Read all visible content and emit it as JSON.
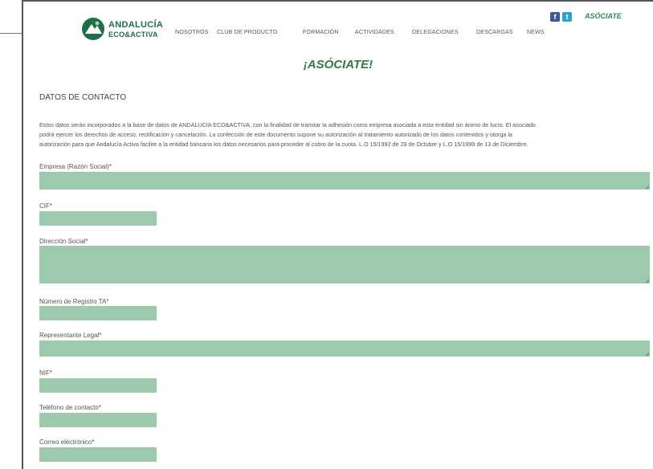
{
  "header": {
    "logo_line1": "ANDALUCÍA",
    "logo_line2": "ECO&ACTIVA",
    "nav": [
      "NOSOTROS",
      "CLUB DE PRODUCTO",
      "FORMACIÓN",
      "ACTIVIDADES",
      "DELEGACIONES",
      "DESCARGAS",
      "NEWS"
    ],
    "social": {
      "facebook_glyph": "f",
      "twitter_glyph": "t",
      "facebook_icon": "facebook-icon",
      "twitter_icon": "twitter-icon"
    },
    "asociate_link": "ASÓCIATE"
  },
  "page": {
    "title": "¡ASÓCIATE!",
    "section_title": "DATOS DE CONTACTO",
    "legal_lines": [
      "Estos datos serán incorporados a la base de datos de ANDALUCIA ECO&ACTIVA, con la finalidad de tramitar la adhesión como empresa asociada a esta entidad sin ánimo de lucro. El asociado",
      "podrá ejercer los derechos de acceso, rectificación y cancelación. La confección de este documento supone su autorización al tratamiento autorizado de los datos contenidos y otorga la",
      "autorización para que Andalucía Activa facilite a la entidad bancaria los datos necesarios para proceder al cobro de la cuota. L.O 15/1992 de 29 de Octubre y L.O 15/1999 de 13 de Diciembre."
    ]
  },
  "form": {
    "fields": [
      {
        "label": "Empresa (Razón Social)*",
        "value": ""
      },
      {
        "label": "CIF*",
        "value": ""
      },
      {
        "label": "Dirección Social*",
        "value": ""
      },
      {
        "label": "Número de Registro TA*",
        "value": ""
      },
      {
        "label": "Representante Legal*",
        "value": ""
      },
      {
        "label": "NIF*",
        "value": ""
      },
      {
        "label": "Teléfono de contacto*",
        "value": ""
      },
      {
        "label": "Correo electrónico*",
        "value": ""
      }
    ]
  },
  "colors": {
    "brand_green": "#1e6e47",
    "field_bg": "#9dc9ad",
    "title_green": "#2e7a4a"
  }
}
